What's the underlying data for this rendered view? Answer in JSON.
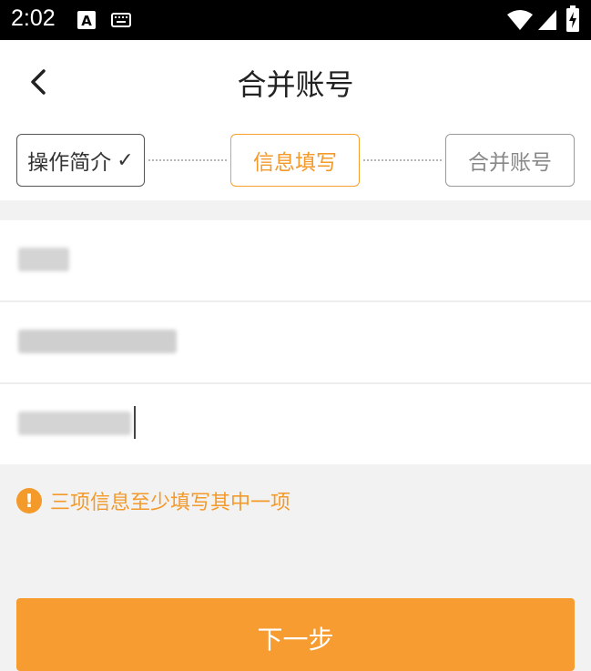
{
  "status_bar": {
    "time": "2:02",
    "icons": [
      "a-badge-icon",
      "keyboard-icon",
      "wifi-icon",
      "signal-icon",
      "battery-charging-icon"
    ]
  },
  "header": {
    "title": "合并账号",
    "back_icon": "chevron-left-icon"
  },
  "steps": [
    {
      "label": "操作简介",
      "state": "done",
      "check": "✓"
    },
    {
      "label": "信息填写",
      "state": "active"
    },
    {
      "label": "合并账号",
      "state": "pending"
    }
  ],
  "colors": {
    "accent": "#f69c30",
    "status_bar": "#000000",
    "page_bg": "#f2f2f2"
  },
  "form": {
    "fields": [
      {
        "value": "",
        "redacted": true
      },
      {
        "value": "",
        "redacted": true
      },
      {
        "value": "",
        "redacted": true,
        "focused": true
      }
    ]
  },
  "hint": {
    "text": "三项信息至少填写其中一项",
    "icon": "exclamation-circle-icon"
  },
  "next_button": {
    "label": "下一步"
  }
}
